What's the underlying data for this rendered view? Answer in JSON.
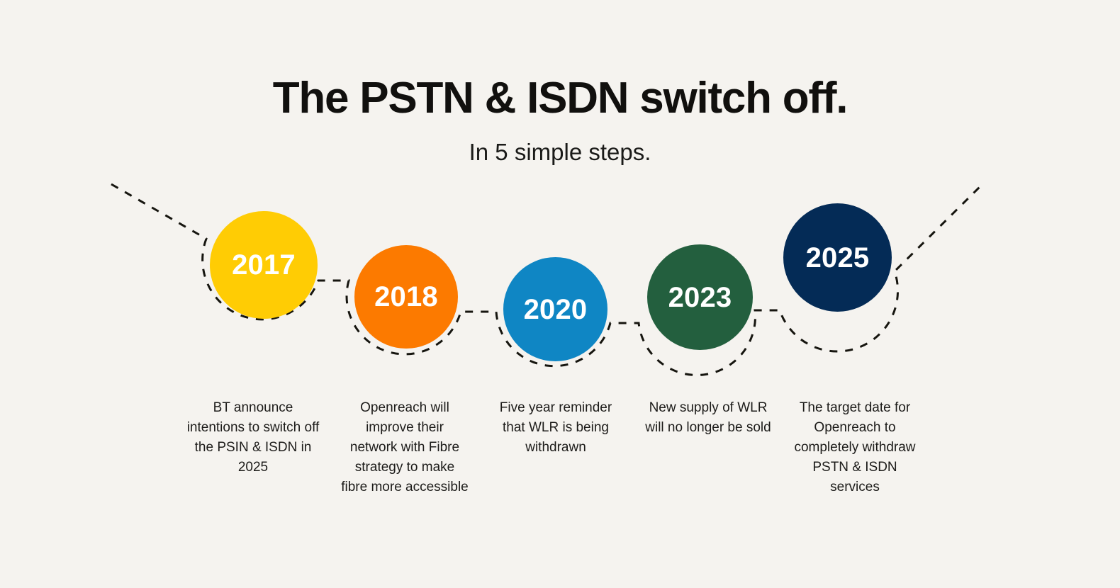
{
  "page": {
    "background_color": "#f5f3ef",
    "text_color": "#1c1b19"
  },
  "header": {
    "title": "The PSTN & ISDN switch off.",
    "subtitle": "In 5 simple steps."
  },
  "timeline": {
    "connector_style": "dashed",
    "connector_color": "#16150f",
    "steps": [
      {
        "year": "2017",
        "color": "#ffcc04",
        "caption": "BT announce intentions to switch off the PSIN & ISDN in 2025"
      },
      {
        "year": "2018",
        "color": "#fc7a00",
        "caption": "Openreach will improve their network with Fibre strategy to make fibre more accessible"
      },
      {
        "year": "2020",
        "color": "#0f86c4",
        "caption": "Five year reminder that WLR is being withdrawn"
      },
      {
        "year": "2023",
        "color": "#235f3e",
        "caption": "New supply of WLR will no longer be sold"
      },
      {
        "year": "2025",
        "color": "#042b56",
        "caption": "The target date for Openreach to completely withdraw PSTN & ISDN services"
      }
    ]
  }
}
